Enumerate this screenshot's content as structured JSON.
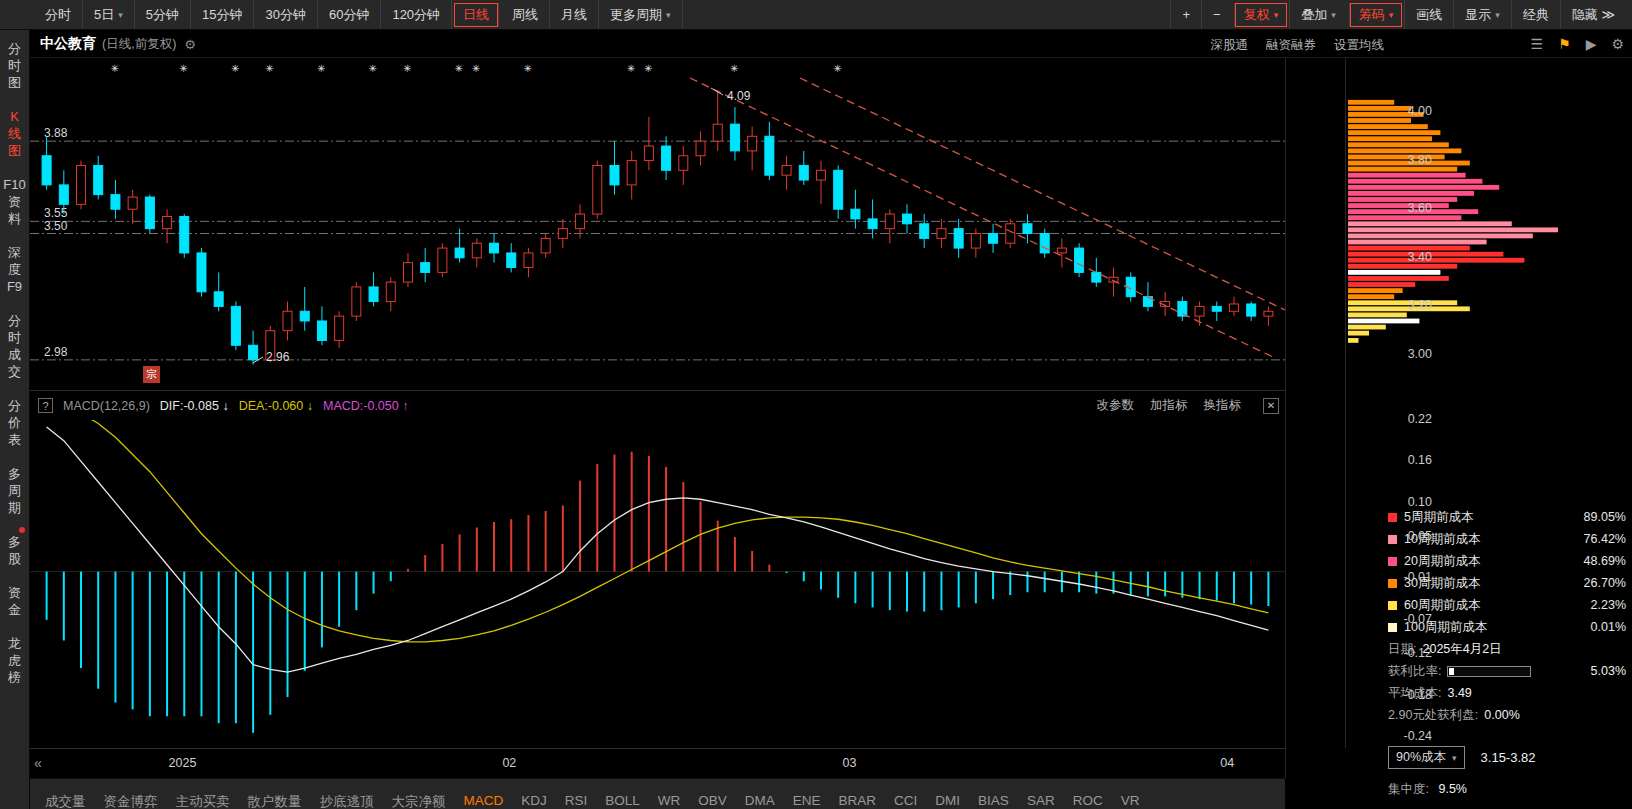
{
  "topbar": {
    "left_items": [
      {
        "label": "分时",
        "name": "minute",
        "arrow": false,
        "active": false
      },
      {
        "label": "5日",
        "name": "five-day",
        "arrow": true,
        "active": false
      },
      {
        "label": "5分钟",
        "name": "5min",
        "arrow": false,
        "active": false
      },
      {
        "label": "15分钟",
        "name": "15min",
        "arrow": false,
        "active": false
      },
      {
        "label": "30分钟",
        "name": "30min",
        "arrow": false,
        "active": false
      },
      {
        "label": "60分钟",
        "name": "60min",
        "arrow": false,
        "active": false
      },
      {
        "label": "120分钟",
        "name": "120min",
        "arrow": false,
        "active": false
      },
      {
        "label": "日线",
        "name": "daily",
        "arrow": false,
        "active": true
      },
      {
        "label": "周线",
        "name": "weekly",
        "arrow": false,
        "active": false
      },
      {
        "label": "月线",
        "name": "monthly",
        "arrow": false,
        "active": false
      },
      {
        "label": "更多周期",
        "name": "more-periods",
        "arrow": true,
        "active": false
      }
    ],
    "right_items": [
      {
        "label": "+",
        "name": "zoom-in",
        "arrow": false,
        "accent": false
      },
      {
        "label": "−",
        "name": "zoom-out",
        "arrow": false,
        "accent": false
      },
      {
        "label": "复权",
        "name": "price-adjust",
        "arrow": true,
        "accent": true
      },
      {
        "label": "叠加",
        "name": "overlay",
        "arrow": true,
        "accent": false
      },
      {
        "label": "筹码",
        "name": "chip-distribution",
        "arrow": true,
        "accent": true
      },
      {
        "label": "画线",
        "name": "draw-line",
        "arrow": false,
        "accent": false
      },
      {
        "label": "显示",
        "name": "display",
        "arrow": true,
        "accent": false
      },
      {
        "label": "经典",
        "name": "classic",
        "arrow": false,
        "accent": false
      },
      {
        "label": "隐藏 ≫",
        "name": "hide",
        "arrow": false,
        "accent": false
      }
    ]
  },
  "sidebar": {
    "items": [
      {
        "label": "分\n时\n图",
        "name": "timeshare-chart",
        "active": false,
        "badge": false
      },
      {
        "label": "K\n线\n图",
        "name": "kline-chart",
        "active": true,
        "badge": false
      },
      {
        "label": "F10\n资\n料",
        "name": "f10-info",
        "active": false,
        "badge": false
      },
      {
        "label": "深\n度\nF9",
        "name": "depth-f9",
        "active": false,
        "badge": false
      },
      {
        "label": "分\n时\n成\n交",
        "name": "timeshare-trades",
        "active": false,
        "badge": false
      },
      {
        "label": "分\n价\n表",
        "name": "price-volume-table",
        "active": false,
        "badge": false
      },
      {
        "label": "多\n周\n期",
        "name": "multi-period",
        "active": false,
        "badge": false
      },
      {
        "label": "多\n股",
        "name": "multi-stock",
        "active": false,
        "badge": true
      },
      {
        "label": "资\n金",
        "name": "funds",
        "active": false,
        "badge": false
      },
      {
        "label": "龙\n虎\n榜",
        "name": "dragon-tiger-list",
        "active": false,
        "badge": false
      }
    ]
  },
  "chart_header": {
    "title": "中公教育",
    "subtitle": "(日线,前复权)",
    "gear": "⚙",
    "links": [
      "深股通",
      "融资融券",
      "设置均线"
    ],
    "icons": [
      {
        "glyph": "☰",
        "name": "list-icon",
        "color": "#9a9a9a"
      },
      {
        "glyph": "⚑",
        "name": "flag-icon",
        "color": "#ffb000"
      },
      {
        "glyph": "▶",
        "name": "play-icon",
        "color": "#9a9a9a"
      },
      {
        "glyph": "⚙",
        "name": "settings-gear-icon",
        "color": "#9a9a9a"
      }
    ]
  },
  "macd_panel": {
    "help": "?",
    "name": "MACD(12,26,9)",
    "dif_label": "DIF:-0.085",
    "dif_arrow": "↓",
    "dea_label": "DEA:-0.060",
    "dea_arrow": "↓",
    "macd_label": "MACD:-0.050",
    "macd_arrow": "↑",
    "actions": [
      "改参数",
      "加指标",
      "换指标"
    ],
    "close": "✕"
  },
  "timeline": {
    "back": "«",
    "ticks": [
      {
        "label": "2025",
        "f": 0.12
      },
      {
        "label": "02",
        "f": 0.386
      },
      {
        "label": "03",
        "f": 0.657
      },
      {
        "label": "04",
        "f": 0.958
      }
    ]
  },
  "bottom_tabs": {
    "active": "MACD",
    "items": [
      "成交量",
      "资金博弈",
      "主动买卖",
      "散户数量",
      "抄底逃顶",
      "大宗净额",
      "MACD",
      "KDJ",
      "RSI",
      "BOLL",
      "WR",
      "OBV",
      "DMA",
      "ENE",
      "BRAR",
      "CCI",
      "DMI",
      "BIAS",
      "SAR",
      "ROC",
      "VR"
    ]
  },
  "chip_panel": {
    "legend": [
      {
        "label": "5周期前成本",
        "value": "89.05%",
        "color": "#ff3030"
      },
      {
        "label": "10周期前成本",
        "value": "76.42%",
        "color": "#ff8ca0"
      },
      {
        "label": "20周期前成本",
        "value": "48.69%",
        "color": "#ff4f87"
      },
      {
        "label": "30周期前成本",
        "value": "26.70%",
        "color": "#ff8a00"
      },
      {
        "label": "60周期前成本",
        "value": "2.23%",
        "color": "#ffe14d"
      },
      {
        "label": "100周期前成本",
        "value": "0.01%",
        "color": "#fff6c8"
      }
    ],
    "info": [
      {
        "label": "日期:",
        "value": "2025年4月2日",
        "bar": false
      },
      {
        "label": "获利比率:",
        "value": "5.03%",
        "bar": true,
        "pct": 5.03
      },
      {
        "label": "平均成本:",
        "value": "3.49",
        "bar": false
      },
      {
        "label": "2.90元处获利盘:",
        "value": "0.00%",
        "bar": false
      }
    ],
    "range_label": "90%成本",
    "range_value": "3.15-3.82",
    "concentration_label": "集中度:",
    "concentration_value": "9.5%"
  },
  "colors": {
    "accent": "#ff4632",
    "up": "#e23b2e",
    "down": "#00e5ff",
    "dif": "#e8e8e8",
    "dea": "#d6c400",
    "macd_value": "#d44fd4",
    "trend": "#d9544a"
  },
  "chart_data": [
    {
      "type": "candlestick",
      "name": "main-kline",
      "title": "中公教育 日线 前复权",
      "ylim": [
        2.86,
        4.22
      ],
      "y_ticks": [
        4.0,
        3.8,
        3.6,
        3.4,
        3.2,
        3.0
      ],
      "x_ticks": [
        "2025",
        "02",
        "03",
        "04"
      ],
      "hlines": [
        3.88,
        3.55,
        3.5,
        2.98
      ],
      "high_label": "4.09",
      "low_label": "2.96",
      "block_trade_label": "宗",
      "event_marker_glyph": "✳",
      "event_marker_indices": [
        4,
        8,
        11,
        13,
        16,
        19,
        21,
        24,
        25,
        28,
        34,
        35,
        40,
        46
      ],
      "candles": [
        [
          3.82,
          3.9,
          3.68,
          3.7
        ],
        [
          3.7,
          3.76,
          3.58,
          3.62
        ],
        [
          3.62,
          3.8,
          3.6,
          3.78
        ],
        [
          3.78,
          3.82,
          3.64,
          3.66
        ],
        [
          3.66,
          3.72,
          3.56,
          3.6
        ],
        [
          3.6,
          3.68,
          3.54,
          3.65
        ],
        [
          3.65,
          3.66,
          3.5,
          3.52
        ],
        [
          3.52,
          3.6,
          3.46,
          3.57
        ],
        [
          3.57,
          3.58,
          3.4,
          3.42
        ],
        [
          3.42,
          3.44,
          3.24,
          3.26
        ],
        [
          3.26,
          3.34,
          3.18,
          3.2
        ],
        [
          3.2,
          3.22,
          3.02,
          3.04
        ],
        [
          3.04,
          3.1,
          2.96,
          2.98
        ],
        [
          2.98,
          3.12,
          2.97,
          3.1
        ],
        [
          3.1,
          3.22,
          3.06,
          3.18
        ],
        [
          3.18,
          3.28,
          3.1,
          3.14
        ],
        [
          3.14,
          3.2,
          3.04,
          3.06
        ],
        [
          3.06,
          3.18,
          3.03,
          3.16
        ],
        [
          3.16,
          3.3,
          3.14,
          3.28
        ],
        [
          3.28,
          3.34,
          3.2,
          3.22
        ],
        [
          3.22,
          3.32,
          3.18,
          3.3
        ],
        [
          3.3,
          3.42,
          3.28,
          3.38
        ],
        [
          3.38,
          3.44,
          3.3,
          3.34
        ],
        [
          3.34,
          3.46,
          3.32,
          3.44
        ],
        [
          3.44,
          3.52,
          3.38,
          3.4
        ],
        [
          3.4,
          3.48,
          3.36,
          3.46
        ],
        [
          3.46,
          3.5,
          3.38,
          3.42
        ],
        [
          3.42,
          3.46,
          3.34,
          3.36
        ],
        [
          3.36,
          3.44,
          3.32,
          3.42
        ],
        [
          3.42,
          3.5,
          3.4,
          3.48
        ],
        [
          3.48,
          3.56,
          3.44,
          3.52
        ],
        [
          3.52,
          3.62,
          3.48,
          3.58
        ],
        [
          3.58,
          3.8,
          3.56,
          3.78
        ],
        [
          3.78,
          3.88,
          3.66,
          3.7
        ],
        [
          3.7,
          3.84,
          3.64,
          3.8
        ],
        [
          3.8,
          3.98,
          3.76,
          3.86
        ],
        [
          3.86,
          3.9,
          3.72,
          3.76
        ],
        [
          3.76,
          3.86,
          3.7,
          3.82
        ],
        [
          3.82,
          3.92,
          3.78,
          3.88
        ],
        [
          3.88,
          4.09,
          3.84,
          3.95
        ],
        [
          3.95,
          4.02,
          3.8,
          3.84
        ],
        [
          3.84,
          3.94,
          3.76,
          3.9
        ],
        [
          3.9,
          3.96,
          3.72,
          3.74
        ],
        [
          3.74,
          3.82,
          3.68,
          3.78
        ],
        [
          3.78,
          3.84,
          3.7,
          3.72
        ],
        [
          3.72,
          3.8,
          3.62,
          3.76
        ],
        [
          3.76,
          3.78,
          3.56,
          3.6
        ],
        [
          3.6,
          3.68,
          3.52,
          3.56
        ],
        [
          3.56,
          3.64,
          3.48,
          3.52
        ],
        [
          3.52,
          3.6,
          3.46,
          3.58
        ],
        [
          3.58,
          3.62,
          3.5,
          3.54
        ],
        [
          3.54,
          3.58,
          3.44,
          3.48
        ],
        [
          3.48,
          3.56,
          3.44,
          3.52
        ],
        [
          3.52,
          3.56,
          3.4,
          3.44
        ],
        [
          3.44,
          3.52,
          3.4,
          3.5
        ],
        [
          3.5,
          3.54,
          3.42,
          3.46
        ],
        [
          3.46,
          3.56,
          3.44,
          3.54
        ],
        [
          3.54,
          3.58,
          3.46,
          3.5
        ],
        [
          3.5,
          3.52,
          3.4,
          3.42
        ],
        [
          3.42,
          3.48,
          3.36,
          3.44
        ],
        [
          3.44,
          3.46,
          3.32,
          3.34
        ],
        [
          3.34,
          3.4,
          3.28,
          3.3
        ],
        [
          3.3,
          3.36,
          3.24,
          3.32
        ],
        [
          3.32,
          3.34,
          3.22,
          3.24
        ],
        [
          3.24,
          3.3,
          3.18,
          3.2
        ],
        [
          3.2,
          3.26,
          3.16,
          3.22
        ],
        [
          3.22,
          3.24,
          3.14,
          3.16
        ],
        [
          3.16,
          3.22,
          3.12,
          3.2
        ],
        [
          3.2,
          3.22,
          3.14,
          3.18
        ],
        [
          3.18,
          3.24,
          3.16,
          3.21
        ],
        [
          3.21,
          3.22,
          3.14,
          3.16
        ],
        [
          3.16,
          3.2,
          3.12,
          3.18
        ]
      ]
    },
    {
      "type": "line+bar",
      "name": "macd",
      "params": "MACD(12,26,9)",
      "dif_value": -0.085,
      "dea_value": -0.06,
      "macd_value": -0.05,
      "bar_formula": "2*(dif-dea)",
      "y_ticks": [
        0.22,
        0.16,
        0.1,
        0.05,
        -0.01,
        -0.07,
        -0.12,
        -0.18,
        -0.24
      ],
      "dif": [
        0.21,
        0.19,
        0.16,
        0.13,
        0.1,
        0.07,
        0.04,
        0.01,
        -0.02,
        -0.05,
        -0.08,
        -0.105,
        -0.135,
        -0.142,
        -0.146,
        -0.14,
        -0.133,
        -0.126,
        -0.12,
        -0.113,
        -0.107,
        -0.1,
        -0.09,
        -0.08,
        -0.07,
        -0.06,
        -0.05,
        -0.04,
        -0.028,
        -0.015,
        0.0,
        0.03,
        0.055,
        0.075,
        0.09,
        0.1,
        0.105,
        0.107,
        0.105,
        0.1,
        0.095,
        0.09,
        0.083,
        0.078,
        0.072,
        0.065,
        0.057,
        0.049,
        0.041,
        0.033,
        0.026,
        0.019,
        0.013,
        0.008,
        0.004,
        0.0,
        -0.003,
        -0.006,
        -0.01,
        -0.014,
        -0.018,
        -0.023,
        -0.028,
        -0.034,
        -0.04,
        -0.046,
        -0.052,
        -0.058,
        -0.064,
        -0.071,
        -0.078,
        -0.085
      ],
      "dea": [
        0.245,
        0.24,
        0.23,
        0.215,
        0.195,
        0.17,
        0.145,
        0.115,
        0.085,
        0.055,
        0.03,
        0.005,
        -0.018,
        -0.038,
        -0.055,
        -0.068,
        -0.078,
        -0.086,
        -0.092,
        -0.097,
        -0.1,
        -0.102,
        -0.102,
        -0.1,
        -0.097,
        -0.092,
        -0.086,
        -0.078,
        -0.069,
        -0.059,
        -0.048,
        -0.036,
        -0.023,
        -0.01,
        0.003,
        0.016,
        0.029,
        0.042,
        0.054,
        0.063,
        0.07,
        0.075,
        0.078,
        0.079,
        0.079,
        0.078,
        0.076,
        0.072,
        0.067,
        0.061,
        0.055,
        0.048,
        0.041,
        0.034,
        0.027,
        0.02,
        0.014,
        0.009,
        0.005,
        0.001,
        -0.003,
        -0.007,
        -0.012,
        -0.017,
        -0.022,
        -0.028,
        -0.033,
        -0.038,
        -0.043,
        -0.048,
        -0.054,
        -0.06
      ]
    },
    {
      "type": "chip-distribution",
      "name": "chip-histogram",
      "colors": {
        "c5": "#ff3030",
        "c10": "#ff8ca0",
        "c20": "#ff4f87",
        "c30": "#ff8a00",
        "c60": "#ffe14d",
        "c100": "#fff6c8",
        "white": "#ffffff"
      },
      "rows": [
        [
          4.04,
          0.22,
          "c30"
        ],
        [
          4.015,
          0.3,
          "c30"
        ],
        [
          3.99,
          0.36,
          "c30"
        ],
        [
          3.965,
          0.3,
          "c30"
        ],
        [
          3.94,
          0.38,
          "c30"
        ],
        [
          3.915,
          0.44,
          "c30"
        ],
        [
          3.89,
          0.4,
          "c30"
        ],
        [
          3.865,
          0.48,
          "c30"
        ],
        [
          3.84,
          0.54,
          "c30"
        ],
        [
          3.815,
          0.46,
          "c30"
        ],
        [
          3.79,
          0.58,
          "c30"
        ],
        [
          3.765,
          0.52,
          "c30"
        ],
        [
          3.74,
          0.56,
          "c20"
        ],
        [
          3.715,
          0.64,
          "c20"
        ],
        [
          3.69,
          0.72,
          "c20"
        ],
        [
          3.665,
          0.6,
          "c20"
        ],
        [
          3.64,
          0.52,
          "c20"
        ],
        [
          3.615,
          0.48,
          "c20"
        ],
        [
          3.59,
          0.62,
          "c20"
        ],
        [
          3.565,
          0.54,
          "c20"
        ],
        [
          3.54,
          0.78,
          "c10"
        ],
        [
          3.515,
          1.0,
          "c10"
        ],
        [
          3.49,
          0.88,
          "c10"
        ],
        [
          3.465,
          0.66,
          "c10"
        ],
        [
          3.44,
          0.58,
          "c5"
        ],
        [
          3.415,
          0.74,
          "c5"
        ],
        [
          3.39,
          0.84,
          "c5"
        ],
        [
          3.365,
          0.52,
          "c5"
        ],
        [
          3.34,
          0.44,
          "white"
        ],
        [
          3.315,
          0.48,
          "c5"
        ],
        [
          3.29,
          0.32,
          "c5"
        ],
        [
          3.265,
          0.26,
          "c30"
        ],
        [
          3.24,
          0.22,
          "c30"
        ],
        [
          3.215,
          0.52,
          "c60"
        ],
        [
          3.19,
          0.58,
          "c60"
        ],
        [
          3.165,
          0.28,
          "c60"
        ],
        [
          3.14,
          0.34,
          "white"
        ],
        [
          3.115,
          0.18,
          "c60"
        ],
        [
          3.09,
          0.1,
          "c60"
        ],
        [
          3.06,
          0.05,
          "c60"
        ]
      ]
    }
  ]
}
